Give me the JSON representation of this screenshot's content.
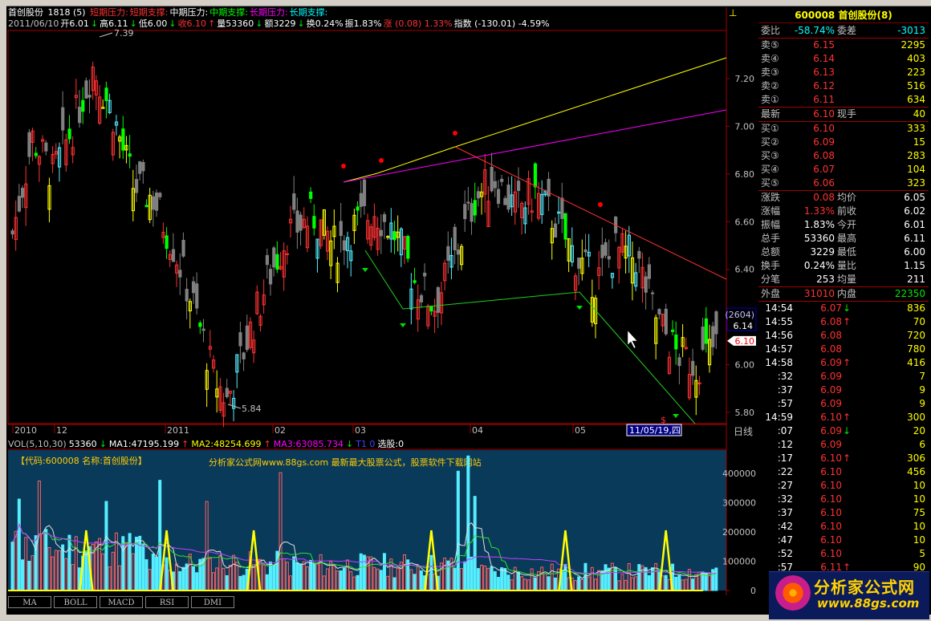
{
  "stock": {
    "name": "首创股份",
    "counter": "1818 (5)",
    "code_title": "600008 首创股份(8)"
  },
  "info_bar": {
    "lines": [
      {
        "text": "短期压力",
        "color": "#ff3232"
      },
      {
        "text": "短期支撑",
        "color": "#ff3232"
      },
      {
        "text": "中期压力",
        "color": "#ffffff"
      },
      {
        "text": "中期支撑",
        "color": "#00ff00"
      },
      {
        "text": "长期压力",
        "color": "#ff00ff"
      },
      {
        "text": "长期支撑",
        "color": "#00ffff"
      }
    ],
    "quote": [
      {
        "text": "2011/06/10",
        "color": "#c0c0c0"
      },
      {
        "text": "开6.01",
        "color": "#ffffff"
      },
      {
        "text": "↓",
        "color": "#00e600"
      },
      {
        "text": "高6.11",
        "color": "#ffffff"
      },
      {
        "text": "↓",
        "color": "#00e600"
      },
      {
        "text": "低6.00",
        "color": "#ffffff"
      },
      {
        "text": "↓",
        "color": "#00e600"
      },
      {
        "text": "收6.10",
        "color": "#ff3232"
      },
      {
        "text": "↑",
        "color": "#ff3232"
      },
      {
        "text": "量53360",
        "color": "#ffffff"
      },
      {
        "text": "↓",
        "color": "#00e600"
      },
      {
        "text": "额3229",
        "color": "#ffffff"
      },
      {
        "text": "↓",
        "color": "#00e600"
      },
      {
        "text": "换0.24%",
        "color": "#ffffff"
      },
      {
        "text": "振1.83%",
        "color": "#ffffff"
      },
      {
        "text": "涨 (0.08) 1.33%",
        "color": "#ff3232"
      },
      {
        "text": "指数 (-130.01) -4.59%",
        "color": "#ffffff"
      }
    ]
  },
  "price_axis": {
    "labels": [
      "7.20",
      "7.00",
      "6.80",
      "6.60",
      "6.40",
      "6.20",
      "6.00",
      "5.80"
    ],
    "current_box": {
      "count": "(2604)",
      "price": "6.14"
    },
    "last_price_tag": "6.10"
  },
  "price_annotations": {
    "high_label": "7.39",
    "low_label": "5.84"
  },
  "time_axis": {
    "labels": [
      "2010",
      "12",
      "2011",
      "02",
      "03",
      "04",
      "05"
    ],
    "cursor_date": "11/05/19,四",
    "period": "日线"
  },
  "volume_info": [
    {
      "text": "VOL(5,10,30)",
      "color": "#c0c0c0"
    },
    {
      "text": "53360",
      "color": "#ffffff"
    },
    {
      "text": "↓",
      "color": "#00e600"
    },
    {
      "text": "MA1:47195.199",
      "color": "#ffffff"
    },
    {
      "text": "↑",
      "color": "#ff3232"
    },
    {
      "text": "MA2:48254.699",
      "color": "#ffff00"
    },
    {
      "text": "↑",
      "color": "#ff3232"
    },
    {
      "text": "MA3:63085.734",
      "color": "#ff00ff"
    },
    {
      "text": "↓",
      "color": "#00e600"
    },
    {
      "text": "T1 0",
      "color": "#4040ff"
    },
    {
      "text": "选股:0",
      "color": "#ffffff"
    }
  ],
  "volume_panel": {
    "caption": "【代码:600008 名称:首创股份】",
    "watermark": "分析家公式网www.88gs.com 最新最大股票公式，股票软件下载网站",
    "axis_labels": [
      "400000",
      "300000",
      "200000",
      "100000",
      "0"
    ]
  },
  "tabs": [
    "MA",
    "BOLL",
    "MACD",
    "RSI",
    "DMI"
  ],
  "side": {
    "wei": {
      "wb_label": "委比",
      "wb_value": "-58.74%",
      "wc_label": "委差",
      "wc_value": "-3013"
    },
    "sell": [
      {
        "label": "卖⑤",
        "price": "6.15",
        "vol": "2295"
      },
      {
        "label": "卖④",
        "price": "6.14",
        "vol": "403"
      },
      {
        "label": "卖③",
        "price": "6.13",
        "vol": "223"
      },
      {
        "label": "卖②",
        "price": "6.12",
        "vol": "516"
      },
      {
        "label": "卖①",
        "price": "6.11",
        "vol": "634"
      }
    ],
    "latest": {
      "label": "最新",
      "price": "6.10",
      "xs_label": "现手",
      "xs_value": "40"
    },
    "buy": [
      {
        "label": "买①",
        "price": "6.10",
        "vol": "333"
      },
      {
        "label": "买②",
        "price": "6.09",
        "vol": "15"
      },
      {
        "label": "买③",
        "price": "6.08",
        "vol": "283"
      },
      {
        "label": "买④",
        "price": "6.07",
        "vol": "104"
      },
      {
        "label": "买⑤",
        "price": "6.06",
        "vol": "323"
      }
    ],
    "stats": [
      {
        "l1": "涨跌",
        "v1": "0.08",
        "c1": "red",
        "l2": "均价",
        "v2": "6.05",
        "c2": "white"
      },
      {
        "l1": "涨幅",
        "v1": "1.33%",
        "c1": "red",
        "l2": "前收",
        "v2": "6.02",
        "c2": "white"
      },
      {
        "l1": "振幅",
        "v1": "1.83%",
        "c1": "white",
        "l2": "今开",
        "v2": "6.01",
        "c2": "white"
      },
      {
        "l1": "总手",
        "v1": "53360",
        "c1": "white",
        "l2": "最高",
        "v2": "6.11",
        "c2": "white"
      },
      {
        "l1": "总额",
        "v1": "3229",
        "c1": "white",
        "l2": "最低",
        "v2": "6.00",
        "c2": "white"
      },
      {
        "l1": "换手",
        "v1": "0.24%",
        "c1": "white",
        "l2": "量比",
        "v2": "1.15",
        "c2": "white"
      },
      {
        "l1": "分笔",
        "v1": "253",
        "c1": "white",
        "l2": "均量",
        "v2": "211",
        "c2": "white"
      }
    ],
    "inout": {
      "out_label": "外盘",
      "out_value": "31010",
      "in_label": "内盘",
      "in_value": "22350"
    },
    "ticks": [
      {
        "t": "14:54",
        "p": "6.07",
        "arrow": "↓",
        "ac": "green",
        "v": "836",
        "pc": "red"
      },
      {
        "t": "14:55",
        "p": "6.08",
        "arrow": "↑",
        "ac": "red",
        "v": "70",
        "pc": "red"
      },
      {
        "t": "14:56",
        "p": "6.08",
        "arrow": "",
        "ac": "red",
        "v": "720",
        "pc": "red"
      },
      {
        "t": "14:57",
        "p": "6.08",
        "arrow": "",
        "ac": "red",
        "v": "780",
        "pc": "red"
      },
      {
        "t": "14:58",
        "p": "6.09",
        "arrow": "↑",
        "ac": "red",
        "v": "416",
        "pc": "red"
      },
      {
        "t": ":32",
        "p": "6.09",
        "arrow": "",
        "ac": "red",
        "v": "7",
        "pc": "red"
      },
      {
        "t": ":37",
        "p": "6.09",
        "arrow": "",
        "ac": "red",
        "v": "9",
        "pc": "red"
      },
      {
        "t": ":57",
        "p": "6.09",
        "arrow": "",
        "ac": "red",
        "v": "9",
        "pc": "red"
      },
      {
        "t": "14:59",
        "p": "6.10",
        "arrow": "↑",
        "ac": "red",
        "v": "300",
        "pc": "red"
      },
      {
        "t": ":07",
        "p": "6.09",
        "arrow": "↓",
        "ac": "green",
        "v": "20",
        "pc": "red"
      },
      {
        "t": ":12",
        "p": "6.09",
        "arrow": "",
        "ac": "red",
        "v": "6",
        "pc": "red"
      },
      {
        "t": ":17",
        "p": "6.10",
        "arrow": "↑",
        "ac": "red",
        "v": "306",
        "pc": "red"
      },
      {
        "t": ":22",
        "p": "6.10",
        "arrow": "",
        "ac": "red",
        "v": "456",
        "pc": "red"
      },
      {
        "t": ":27",
        "p": "6.10",
        "arrow": "",
        "ac": "red",
        "v": "10",
        "pc": "red"
      },
      {
        "t": ":32",
        "p": "6.10",
        "arrow": "",
        "ac": "red",
        "v": "10",
        "pc": "red"
      },
      {
        "t": ":37",
        "p": "6.10",
        "arrow": "",
        "ac": "red",
        "v": "75",
        "pc": "red"
      },
      {
        "t": ":42",
        "p": "6.10",
        "arrow": "",
        "ac": "red",
        "v": "10",
        "pc": "red"
      },
      {
        "t": ":47",
        "p": "6.10",
        "arrow": "",
        "ac": "red",
        "v": "10",
        "pc": "red"
      },
      {
        "t": ":52",
        "p": "6.10",
        "arrow": "",
        "ac": "red",
        "v": "5",
        "pc": "red"
      },
      {
        "t": ":57",
        "p": "6.11",
        "arrow": "↑",
        "ac": "red",
        "v": "90",
        "pc": "red"
      }
    ]
  },
  "logo": {
    "line1": "分析家公式网",
    "line2": "www.88gs.com"
  },
  "colors": {
    "up": "#ff3232",
    "down": "#808080",
    "cyan": "#55eeff",
    "yellow": "#ffff00",
    "green": "#00ff00",
    "magenta": "#ff00ff",
    "red_line": "#ff3030",
    "axis": "#a00000"
  }
}
